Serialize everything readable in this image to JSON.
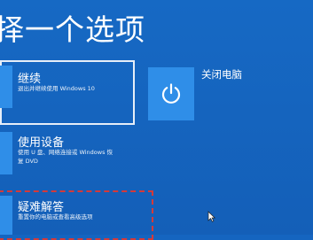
{
  "page": {
    "title": "择一个选项"
  },
  "options": [
    {
      "label": "继续",
      "description": "退出并继续使用 Windows 10"
    },
    {
      "label": "使用设备",
      "description": "使用 U 盘、网络连接或 Windows 恢\n复 DVD"
    },
    {
      "label": "疑难解答",
      "description": "重置你的电脑或查看高级选项"
    },
    {
      "label": "关闭电脑",
      "description": ""
    }
  ],
  "icons": {
    "continue": "arrow-right-icon",
    "device": "usb-device-icon",
    "troubleshoot": "tools-icon",
    "power": "power-icon"
  },
  "colors": {
    "background": "#1669c4",
    "tile": "#2f8ee8",
    "highlight": "#d43a3a"
  }
}
